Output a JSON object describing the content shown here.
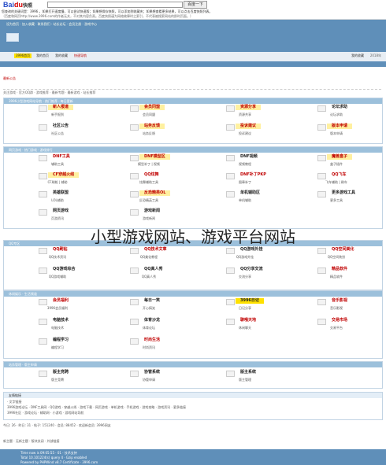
{
  "baidu": {
    "logo_a": "Bai",
    "logo_b": "du",
    "logo_c": "快照",
    "search_button": "百度一下",
    "note": "您查询的关键词是：3996 。如果打开速度慢，可以尝试快速版；如果想保存快照，可以添加到收藏夹；如果想查看更多结果，可以点击百度快照列表。",
    "note2": "（百度和网页http://www.3996.com的作者无关，不对其内容负责。百度快照谨为网络故障时之索引，不代表被搜索网站的即时页面。）"
  },
  "header": {
    "toplinks": "设为首页 · 加入收藏 · 联系我们 · 站长论坛 · 会员注册 · 游戏中心"
  },
  "nav": {
    "home": "3996首页",
    "tab1": "我的首页",
    "tab2": "我的收藏",
    "tab3": "快速导航",
    "mark": "我的收藏",
    "dot": "2018年"
  },
  "strip1": "最新公告",
  "strip2": "关注游戏 · 官方QQ群 · 游戏推荐 · 最新专题 · 最新游戏 · 站长推荐",
  "panel1": {
    "head": "3996小型游戏网站导航 · 热门推荐 · 每日更新",
    "rows": [
      [
        {
          "t": "新人报道",
          "c": "#c00000",
          "bg": "#fff0a0"
        },
        {
          "t": "会员同盟",
          "c": "#c00000",
          "bg": "#fff0a0"
        },
        {
          "t": "资源分享",
          "c": "#c00000",
          "bg": "#fff0a0"
        },
        {
          "t": "论坛求助",
          "c": "#222",
          "bg": "transparent"
        }
      ],
      [
        {
          "t": "社区公告",
          "c": "#222",
          "bg": "transparent"
        },
        {
          "t": "站务反馈",
          "c": "#c00000",
          "bg": "#fff0a0"
        },
        {
          "t": "投诉建议",
          "c": "#c00000",
          "bg": "#fff0a0"
        },
        {
          "t": "版本申请",
          "c": "#c00000",
          "bg": "#fff0a0"
        }
      ]
    ],
    "descs": [
      [
        "新手报到",
        "会员同盟",
        "资源共享",
        "论坛求助"
      ],
      [
        "社区公告",
        "站务反馈",
        "投诉建议",
        "版本申请"
      ]
    ]
  },
  "panel2": {
    "head": "网页游戏 · 热门游戏 · 游戏排行",
    "rows": [
      [
        {
          "t": "DNF工具",
          "c": "#c00000",
          "bg": "transparent"
        },
        {
          "t": "DNF模型区",
          "c": "#c00000",
          "bg": "#fff0a0"
        },
        {
          "t": "DNF视频",
          "c": "#222",
          "bg": "transparent"
        },
        {
          "t": "魔兽盒子",
          "c": "#c00000",
          "bg": "#fff0a0"
        }
      ],
      [
        {
          "t": "CF穿越火线",
          "c": "#c00000",
          "bg": "#fff0a0"
        },
        {
          "t": "QQ炫舞",
          "c": "#c00000",
          "bg": "transparent"
        },
        {
          "t": "DNF补丁PKP",
          "c": "#c00000",
          "bg": "transparent"
        },
        {
          "t": "QQ飞车",
          "c": "#c00000",
          "bg": "transparent"
        }
      ],
      [
        {
          "t": "英雄联盟",
          "c": "#222",
          "bg": "transparent"
        },
        {
          "t": "反恐精英OL",
          "c": "#c00000",
          "bg": "#fff0a0"
        },
        {
          "t": "单机辅助区",
          "c": "#222",
          "bg": "transparent"
        },
        {
          "t": "更多游戏工具",
          "c": "#222",
          "bg": "transparent"
        }
      ],
      [
        {
          "t": "网页游戏",
          "c": "#222",
          "bg": "transparent"
        },
        {
          "t": "游戏新闻",
          "c": "#222",
          "bg": "transparent"
        }
      ]
    ],
    "descs": [
      [
        "辅助工具",
        "模型补丁 | 视频",
        "视频教程",
        "盒子插件"
      ],
      [
        "CF刷枪 | 辅助",
        "炫舞辅助工具",
        "图章补丁",
        "飞车辅助 | 刷车"
      ],
      [
        "LOL辅助",
        "反恐精英工具",
        "单机辅助",
        "更多工具"
      ],
      [
        "页游资讯",
        "游戏新闻"
      ]
    ]
  },
  "panel3": {
    "head": "QQ专区",
    "rows": [
      [
        {
          "t": "QQ刷钻",
          "c": "#c00000",
          "bg": "transparent"
        },
        {
          "t": "QQ技术文章",
          "c": "#c00000",
          "bg": "transparent"
        },
        {
          "t": "QQ游戏外挂",
          "c": "#222",
          "bg": "transparent"
        },
        {
          "t": "QQ空间美化",
          "c": "#c00000",
          "bg": "transparent"
        }
      ],
      [
        {
          "t": "QQ游戏综合",
          "c": "#222",
          "bg": "transparent"
        },
        {
          "t": "QQ真人秀",
          "c": "#222",
          "bg": "transparent"
        },
        {
          "t": "QQ分享交流",
          "c": "#222",
          "bg": "transparent"
        },
        {
          "t": "精品软件",
          "c": "#c00000",
          "bg": "transparent"
        }
      ]
    ],
    "descs": [
      [
        "QQ技术资讯",
        "QQ美化教程",
        "QQ游戏外挂",
        "QQ空间装扮"
      ],
      [
        "QQ游戏辅助",
        "QQ真人秀",
        "交流分享",
        "精品软件"
      ]
    ]
  },
  "panel4": {
    "head": "休闲娱乐 · 生活频道",
    "rows": [
      [
        {
          "t": "会员福利",
          "c": "#c00000",
          "bg": "transparent"
        },
        {
          "t": "每日一笑",
          "c": "#222",
          "bg": "transparent"
        },
        {
          "t": "3996日记",
          "c": "#222",
          "bg": "#ffe100"
        },
        {
          "t": "音乐影视",
          "c": "#c00000",
          "bg": "transparent"
        }
      ],
      [
        {
          "t": "电脑技术",
          "c": "#222",
          "bg": "transparent"
        },
        {
          "t": "体育沙龙",
          "c": "#222",
          "bg": "transparent"
        },
        {
          "t": "聊哦天地",
          "c": "#c00000",
          "bg": "transparent"
        },
        {
          "t": "交易市场",
          "c": "#c00000",
          "bg": "transparent"
        }
      ],
      [
        {
          "t": "编程学习",
          "c": "#222",
          "bg": "transparent"
        },
        {
          "t": "时尚生活",
          "c": "#c00000",
          "bg": "transparent"
        }
      ]
    ],
    "descs": [
      [
        "3996会员福利",
        "开心搞笑",
        "日记分享",
        "音乐影视"
      ],
      [
        "电脑技术",
        "体育论坛",
        "休闲聊天",
        "交易平台"
      ],
      [
        "编程学习",
        "时尚资讯"
      ]
    ]
  },
  "panel5": {
    "head": "站务管理 · 版主申请",
    "rows": [
      [
        {
          "t": "版主竞聘",
          "c": "#222",
          "bg": "transparent"
        },
        {
          "t": "协管系统",
          "c": "#222",
          "bg": "transparent"
        },
        {
          "t": "版主系统",
          "c": "#222",
          "bg": "transparent"
        }
      ]
    ],
    "descs": [
      [
        "版主竞聘",
        "协管申请",
        "版主管理"
      ]
    ]
  },
  "links": {
    "head": "友情链接",
    "sub": "· 文字链接",
    "line1": "3996游戏论坛 · DNF工具网 · QQ游戏 · 穿越火线 · 游戏下载 · 网页游戏 · 单机游戏 · 手机游戏 · 游戏攻略 · 游戏资讯 · 更多链接",
    "line2": "3996社区 · 游戏论坛 · 辅助网 · 小游戏 · 游戏网站导航"
  },
  "stats": "今日: 26 · 昨日: 31 · 帖子: 151240 · 会员: 88452 · 欢迎新会员: 3996网友",
  "legend": "新主题 · 无新主题 · 版块关闭 · 外部链接",
  "footer": {
    "line1": "Time now is 09:05:55 · 01 · 技术支持",
    "line2": "Total 10.101224(s) query 4 · Gzip enabled",
    "line3": "Powered by PHPWind v8.7 Certificate · 3996.com"
  },
  "overlay": "小型游戏网站、游戏平台网站"
}
